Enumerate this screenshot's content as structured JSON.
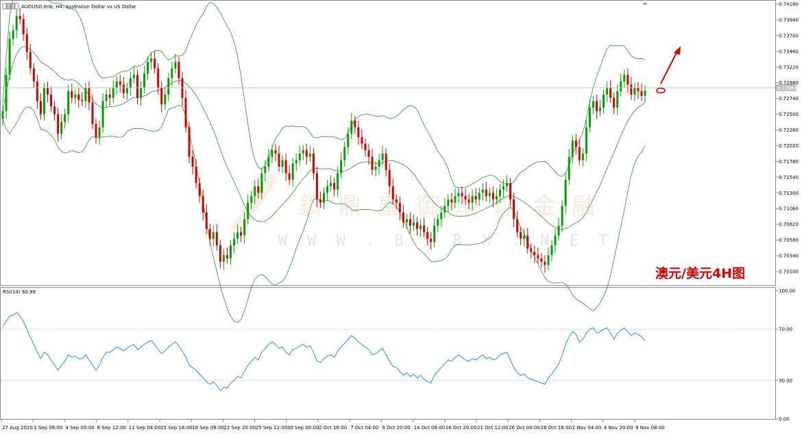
{
  "window": {
    "symbol_title": "AUDUSD.lmb, H4:  Australian Dollar vs US Dollar"
  },
  "annotation": {
    "label": "澳元/美元4H图"
  },
  "watermark": {
    "text_cn": "鑄 鼎 皇 御 環 球 金 融",
    "text_en": "W W W . B I B X . N E T"
  },
  "colors": {
    "bull": "#00a000",
    "bear": "#d40000",
    "bands": "#3ca040",
    "rsi": "#1e90ff",
    "arrow": "#e00000",
    "crosshair": "#c0c0c0"
  },
  "chart_data": [
    {
      "type": "candlestick",
      "title": "AUDUSD.lmb, H4:  Australian Dollar vs US Dollar",
      "ylim": [
        0.6995,
        0.7418
      ],
      "y_ticks": [
        "0.74180",
        "0.73940",
        "0.73700",
        "0.73460",
        "0.73220",
        "0.72980",
        "0.72740",
        "0.72500",
        "0.72260",
        "0.72020",
        "0.71780",
        "0.71540",
        "0.71300",
        "0.71060",
        "0.70820",
        "0.70580",
        "0.70340",
        "0.70100"
      ],
      "x_ticks": [
        "27 Aug 2020",
        "1 Sep 08:00",
        "4 Sep 00:00",
        "8 Sep 12:00",
        "11 Sep 04:00",
        "15 Sep 16:00",
        "18 Sep 08:00",
        "22 Sep 20:00",
        "25 Sep 12:00",
        "30 Sep 00:00",
        "2 Oct 16:00",
        "7 Oct 04:00",
        "9 Oct 20:00",
        "14 Oct 08:00",
        "16 Oct 20:00",
        "21 Oct 12:00",
        "26 Oct 00:00",
        "28 Oct 16:00",
        "2 Nov 04:00",
        "4 Nov 20:00",
        "9 Nov 08:00"
      ],
      "current_price": "0.72861",
      "indicator": "Bollinger Bands",
      "closes": [
        0.7255,
        0.731,
        0.7365,
        0.7378,
        0.74,
        0.7395,
        0.7372,
        0.7345,
        0.732,
        0.73,
        0.727,
        0.725,
        0.729,
        0.728,
        0.7262,
        0.725,
        0.722,
        0.7238,
        0.725,
        0.7285,
        0.7275,
        0.728,
        0.7272,
        0.727,
        0.729,
        0.7268,
        0.7235,
        0.7215,
        0.723,
        0.727,
        0.728,
        0.7275,
        0.729,
        0.73,
        0.7295,
        0.7282,
        0.729,
        0.7305,
        0.731,
        0.7275,
        0.729,
        0.7312,
        0.733,
        0.7335,
        0.732,
        0.729,
        0.7265,
        0.728,
        0.7305,
        0.732,
        0.733,
        0.7305,
        0.7275,
        0.723,
        0.7185,
        0.717,
        0.7145,
        0.7125,
        0.71,
        0.7075,
        0.706,
        0.707,
        0.705,
        0.7025,
        0.7035,
        0.703,
        0.705,
        0.706,
        0.707,
        0.7065,
        0.709,
        0.7115,
        0.7125,
        0.714,
        0.713,
        0.716,
        0.717,
        0.7185,
        0.7195,
        0.719,
        0.717,
        0.718,
        0.716,
        0.715,
        0.7175,
        0.718,
        0.719,
        0.7195,
        0.7185,
        0.719,
        0.716,
        0.712,
        0.7115,
        0.713,
        0.714,
        0.7145,
        0.7135,
        0.716,
        0.718,
        0.72,
        0.722,
        0.724,
        0.723,
        0.7215,
        0.7205,
        0.7195,
        0.7185,
        0.7165,
        0.717,
        0.718,
        0.719,
        0.7165,
        0.714,
        0.712,
        0.7115,
        0.71,
        0.7085,
        0.709,
        0.708,
        0.7085,
        0.7075,
        0.708,
        0.707,
        0.706,
        0.7055,
        0.708,
        0.709,
        0.71,
        0.711,
        0.712,
        0.7115,
        0.7125,
        0.713,
        0.7125,
        0.712,
        0.7115,
        0.7125,
        0.712,
        0.713,
        0.7135,
        0.7125,
        0.713,
        0.712,
        0.7125,
        0.7135,
        0.714,
        0.7145,
        0.712,
        0.709,
        0.707,
        0.706,
        0.7065,
        0.7045,
        0.704,
        0.7035,
        0.703,
        0.7025,
        0.702,
        0.7035,
        0.705,
        0.7065,
        0.708,
        0.711,
        0.715,
        0.7185,
        0.721,
        0.72,
        0.718,
        0.719,
        0.723,
        0.726,
        0.727,
        0.7255,
        0.726,
        0.728,
        0.729,
        0.7275,
        0.726,
        0.7285,
        0.73,
        0.731,
        0.7295,
        0.728,
        0.729,
        0.7285,
        0.7278,
        0.7286
      ]
    },
    {
      "type": "line",
      "title": "RSI(14) 60.99",
      "ylim": [
        0.0,
        100.0
      ],
      "y_ticks": [
        "100.00",
        "70.00",
        "30.00",
        "0.00"
      ],
      "levels": [
        70,
        30
      ],
      "values": [
        72,
        76,
        80,
        81,
        83,
        80,
        76,
        70,
        64,
        58,
        52,
        47,
        52,
        50,
        46,
        42,
        38,
        42,
        45,
        50,
        48,
        49,
        47,
        47,
        50,
        46,
        42,
        38,
        42,
        48,
        52,
        52,
        54,
        56,
        55,
        53,
        55,
        57,
        58,
        54,
        56,
        58,
        60,
        61,
        58,
        54,
        51,
        53,
        56,
        58,
        60,
        57,
        53,
        48,
        42,
        40,
        38,
        35,
        32,
        29,
        27,
        29,
        26,
        22,
        25,
        24,
        28,
        30,
        33,
        32,
        37,
        42,
        45,
        48,
        46,
        52,
        55,
        58,
        60,
        58,
        55,
        56,
        52,
        50,
        54,
        55,
        57,
        58,
        56,
        57,
        52,
        45,
        44,
        47,
        49,
        50,
        48,
        53,
        56,
        59,
        62,
        65,
        63,
        60,
        58,
        56,
        54,
        50,
        51,
        53,
        55,
        50,
        45,
        41,
        40,
        37,
        34,
        36,
        33,
        35,
        32,
        34,
        31,
        29,
        28,
        34,
        37,
        40,
        43,
        46,
        45,
        48,
        50,
        48,
        46,
        45,
        47,
        46,
        48,
        50,
        47,
        48,
        46,
        47,
        50,
        51,
        52,
        46,
        40,
        36,
        34,
        35,
        32,
        31,
        30,
        29,
        28,
        27,
        32,
        35,
        39,
        43,
        50,
        58,
        64,
        68,
        66,
        60,
        62,
        67,
        70,
        71,
        67,
        68,
        70,
        71,
        67,
        62,
        67,
        69,
        71,
        68,
        65,
        67,
        66,
        64,
        61
      ]
    }
  ]
}
